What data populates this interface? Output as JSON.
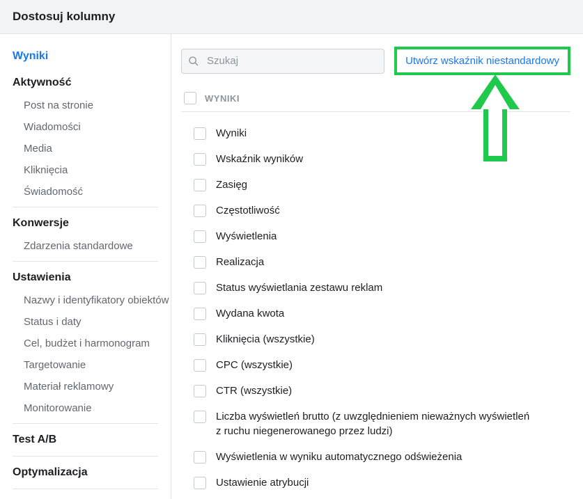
{
  "header": {
    "title": "Dostosuj kolumny"
  },
  "sidebar": {
    "groups": [
      {
        "title": "Wyniki",
        "active": true,
        "items": []
      },
      {
        "title": "Aktywność",
        "items": [
          "Post na stronie",
          "Wiadomości",
          "Media",
          "Kliknięcia",
          "Świadomość"
        ]
      },
      {
        "title": "Konwersje",
        "items": [
          "Zdarzenia standardowe"
        ]
      },
      {
        "title": "Ustawienia",
        "items": [
          "Nazwy i identyfikatory obiektów",
          "Status i daty",
          "Cel, budżet i harmonogram",
          "Targetowanie",
          "Materiał reklamowy",
          "Monitorowanie"
        ]
      },
      {
        "title": "Test A/B",
        "items": []
      },
      {
        "title": "Optymalizacja",
        "items": []
      }
    ]
  },
  "main": {
    "search_placeholder": "Szukaj",
    "custom_metric_button": "Utwórz wskaźnik niestandardowy",
    "section_header": "WYNIKI",
    "checks": [
      "Wyniki",
      "Wskaźnik wyników",
      "Zasięg",
      "Częstotliwość",
      "Wyświetlenia",
      "Realizacja",
      "Status wyświetlania zestawu reklam",
      "Wydana kwota",
      "Kliknięcia (wszystkie)",
      "CPC (wszystkie)",
      "CTR (wszystkie)",
      "Liczba wyświetleń brutto (z uwzględnieniem nieważnych wyświetleń z ruchu niegenerowanego przez ludzi)",
      "Wyświetlenia w wyniku automatycznego odświeżenia",
      "Ustawienie atrybucji"
    ]
  }
}
